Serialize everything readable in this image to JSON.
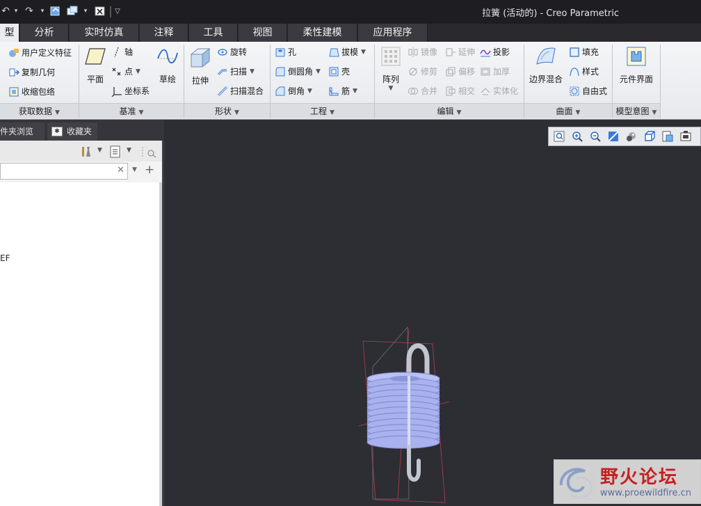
{
  "window": {
    "title": "拉簧 (活动的) - Creo Parametric"
  },
  "tabs": [
    {
      "label": "型"
    },
    {
      "label": "分析"
    },
    {
      "label": "实时仿真"
    },
    {
      "label": "注释"
    },
    {
      "label": "工具"
    },
    {
      "label": "视图"
    },
    {
      "label": "柔性建模"
    },
    {
      "label": "应用程序"
    }
  ],
  "ribbon": {
    "get_data": {
      "footer": "获取数据",
      "items": [
        "用户定义特征",
        "复制几何",
        "收缩包络"
      ]
    },
    "datum": {
      "footer": "基准",
      "plane": "平面",
      "sketch": "草绘",
      "axis": "轴",
      "point": "点",
      "csys": "坐标系"
    },
    "shapes": {
      "footer": "形状",
      "extrude": "拉伸",
      "revolve": "旋转",
      "sweep": "扫描",
      "swept_blend": "扫描混合"
    },
    "engineering": {
      "footer": "工程",
      "hole": "孔",
      "round": "倒圆角",
      "chamfer": "倒角",
      "draft": "拔模",
      "shell": "壳",
      "rib": "筋"
    },
    "editing": {
      "footer": "编辑",
      "pattern": "阵列",
      "mirror": "镜像",
      "trim": "修剪",
      "merge": "合并",
      "extend": "延伸",
      "offset": "偏移",
      "intersect": "相交",
      "project": "投影",
      "thicken": "加厚",
      "solidify": "实体化"
    },
    "surfaces": {
      "footer": "曲面",
      "boundary_blend": "边界混合",
      "fill": "填充",
      "style": "样式",
      "freestyle": "自由式"
    },
    "model_intent": {
      "footer": "模型意图",
      "component_interface": "元件界面"
    }
  },
  "left_panel": {
    "tabs": [
      "件夹浏览器",
      "收藏夹"
    ],
    "tree_text": "EF"
  },
  "watermark": {
    "title": "野火论坛",
    "url": "www.proewildfire.cn"
  },
  "colors": {
    "spring": "#a9b2ee",
    "hook": "#b8bcc8",
    "datum_plane": "#9a3b4a",
    "watermark_red": "#c61f1f"
  }
}
